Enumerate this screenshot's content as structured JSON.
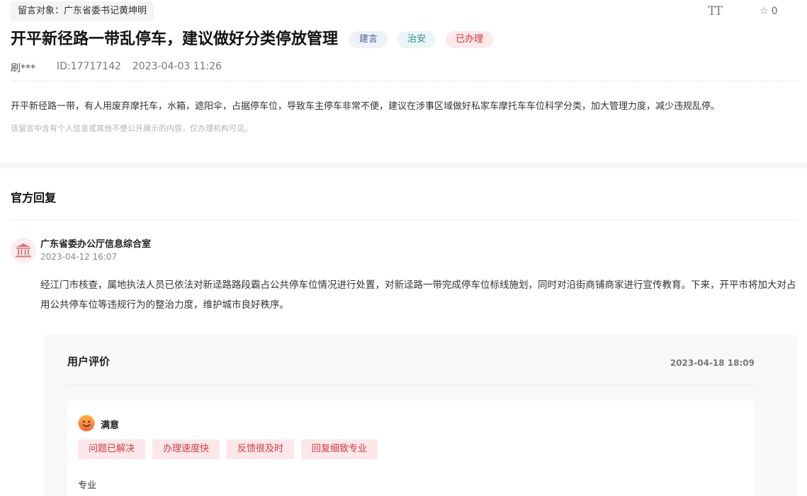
{
  "header": {
    "target_label": "留言对象：广东省委书记黄坤明",
    "font_size_icon_glyph": "TT",
    "favorite_count": "0"
  },
  "post": {
    "title": "开平新径路一带乱停车，建议做好分类停放管理",
    "tags": [
      "建言",
      "治安",
      "已办理"
    ],
    "author": "刷***",
    "id": "ID:17717142",
    "datetime": "2023-04-03 11:26",
    "content": "开平新径路一带，有人用废弃摩托车，水箱，遮阳伞，占据停车位，导致车主停车非常不便，建议在涉事区域做好私家车摩托车车位科学分类，加大管理力度，减少违规乱停。",
    "privacy_note": "该留言中含有个人信息或其他不便公开展示的内容，仅办理机构可见。"
  },
  "reply": {
    "heading": "官方回复",
    "org_name": "广东省委办公厅信息综合室",
    "org_time": "2023-04-12 16:07",
    "text": "经江门市核查，属地执法人员已依法对新迳路路段霸占公共停车位情况进行处置，对新迳路一带完成停车位标线施划，同时对沿街商铺商家进行宣传教育。下来，开平市将加大对占用公共停车位等违规行为的整治力度，维护城市良好秩序。"
  },
  "evaluation": {
    "title": "用户评价",
    "time": "2023-04-18 18:09",
    "satisfaction": "满意",
    "chips": [
      "问题已解决",
      "办理速度快",
      "反馈很及时",
      "回复细致专业"
    ],
    "comment": "专业"
  },
  "colors": {
    "accent_red": "#d13a45",
    "chip_bg": "#fde7e9",
    "panel_bg": "#f7f8fa"
  }
}
